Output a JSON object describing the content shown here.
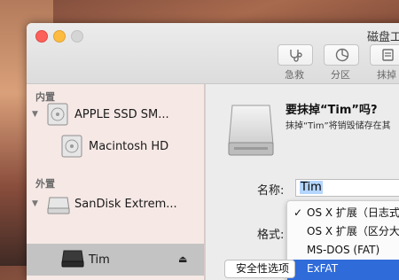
{
  "window": {
    "title": "磁盘工"
  },
  "toolbar": {
    "tools": [
      {
        "label": "急救",
        "icon": "stethoscope-icon"
      },
      {
        "label": "分区",
        "icon": "partition-icon"
      },
      {
        "label": "抹掉",
        "icon": "erase-icon"
      }
    ]
  },
  "sidebar": {
    "sections": [
      {
        "label": "内置",
        "items": [
          {
            "label": "APPLE SSD SM...",
            "icon": "internal-disk-icon"
          },
          {
            "label": "Macintosh HD",
            "icon": "volume-icon"
          }
        ]
      },
      {
        "label": "外置",
        "items": [
          {
            "label": "SanDisk Extrem...",
            "icon": "external-disk-icon"
          },
          {
            "label": "Tim",
            "icon": "volume-icon",
            "selected": true
          }
        ]
      }
    ],
    "eject_symbol": "⏏"
  },
  "erase_dialog": {
    "title": "要抹掉“Tim”吗?",
    "description": "抹掉“Tim”将销毁储存在其",
    "name_label": "名称:",
    "name_value": "Tim",
    "format_label": "格式:",
    "format_options": [
      {
        "label": "OS X 扩展（日志式",
        "checked": true
      },
      {
        "label": "OS X 扩展（区分大",
        "checked": false
      },
      {
        "label": "MS-DOS (FAT)",
        "checked": false
      },
      {
        "label": "ExFAT",
        "highlighted": true
      }
    ],
    "check_symbol": "✓",
    "security_button": "安全性选项"
  }
}
